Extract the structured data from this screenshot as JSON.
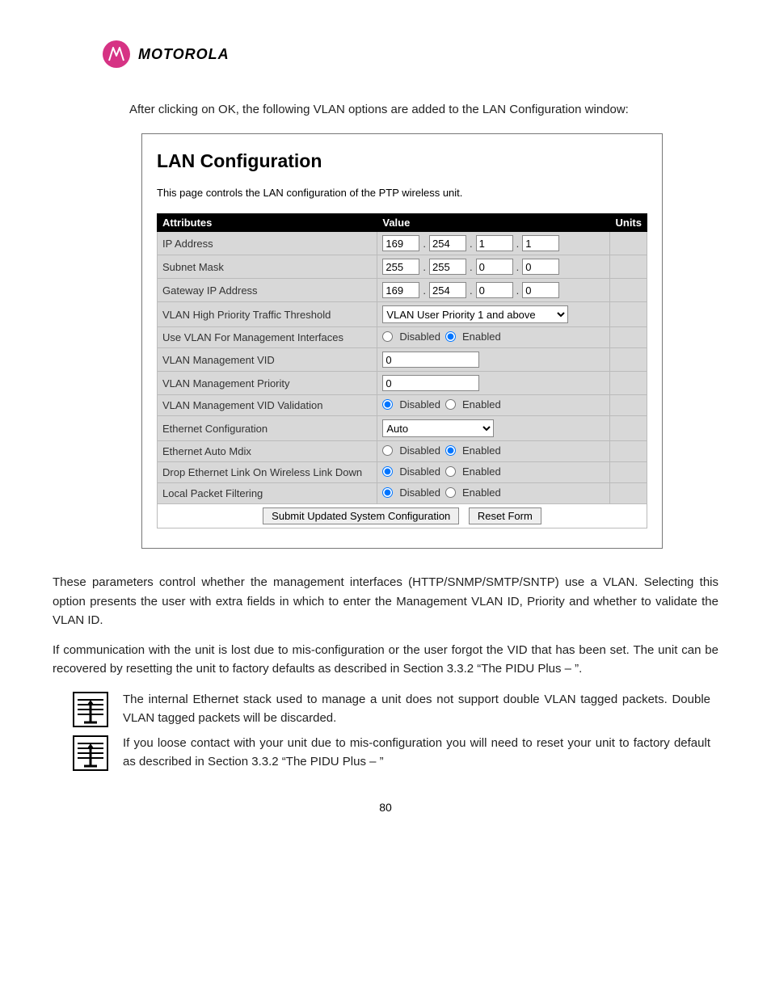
{
  "brand": {
    "name": "MOTOROLA"
  },
  "intro": "After clicking on OK, the following VLAN options are added to the LAN Configuration window:",
  "panel": {
    "title": "LAN Configuration",
    "desc": "This page controls the LAN configuration of the PTP wireless unit.",
    "headers": {
      "attributes": "Attributes",
      "value": "Value",
      "units": "Units"
    },
    "ip_address": {
      "label": "IP Address",
      "octets": [
        "169",
        "254",
        "1",
        "1"
      ]
    },
    "subnet_mask": {
      "label": "Subnet Mask",
      "octets": [
        "255",
        "255",
        "0",
        "0"
      ]
    },
    "gateway": {
      "label": "Gateway IP Address",
      "octets": [
        "169",
        "254",
        "0",
        "0"
      ]
    },
    "vlan_thresh": {
      "label": "VLAN High Priority Traffic Threshold",
      "value": "VLAN User Priority 1 and above"
    },
    "use_vlan_mgmt": {
      "label": "Use VLAN For Management Interfaces",
      "disabled": "Disabled",
      "enabled": "Enabled",
      "selected": "enabled"
    },
    "vlan_mgmt_vid": {
      "label": "VLAN Management VID",
      "value": "0"
    },
    "vlan_mgmt_prio": {
      "label": "VLAN Management Priority",
      "value": "0"
    },
    "vlan_mgmt_valid": {
      "label": "VLAN Management VID Validation",
      "disabled": "Disabled",
      "enabled": "Enabled",
      "selected": "disabled"
    },
    "eth_config": {
      "label": "Ethernet Configuration",
      "value": "Auto"
    },
    "eth_auto_mdix": {
      "label": "Ethernet Auto Mdix",
      "disabled": "Disabled",
      "enabled": "Enabled",
      "selected": "enabled"
    },
    "drop_link": {
      "label": "Drop Ethernet Link On Wireless Link Down",
      "disabled": "Disabled",
      "enabled": "Enabled",
      "selected": "disabled"
    },
    "local_filter": {
      "label": "Local Packet Filtering",
      "disabled": "Disabled",
      "enabled": "Enabled",
      "selected": "disabled"
    },
    "buttons": {
      "submit": "Submit Updated System Configuration",
      "reset": "Reset Form"
    }
  },
  "para1": "These parameters control whether the management interfaces (HTTP/SNMP/SMTP/SNTP) use a VLAN. Selecting this option presents the user with extra fields in which to enter the Management VLAN ID, Priority and whether to validate the VLAN ID.",
  "para2": "If communication with the unit is lost due to mis-configuration or the user forgot the VID that has been set. The unit can be recovered by resetting the unit to factory defaults as described in Section 3.3.2 “The PIDU Plus – ”.",
  "note1": "The internal Ethernet stack used to manage a unit does not support double VLAN tagged packets. Double VLAN tagged packets will be discarded.",
  "note2": "If you loose contact with your unit due to mis-configuration you will need to reset your unit to factory default as described in Section 3.3.2 “The PIDU Plus – ”",
  "page_number": "80"
}
